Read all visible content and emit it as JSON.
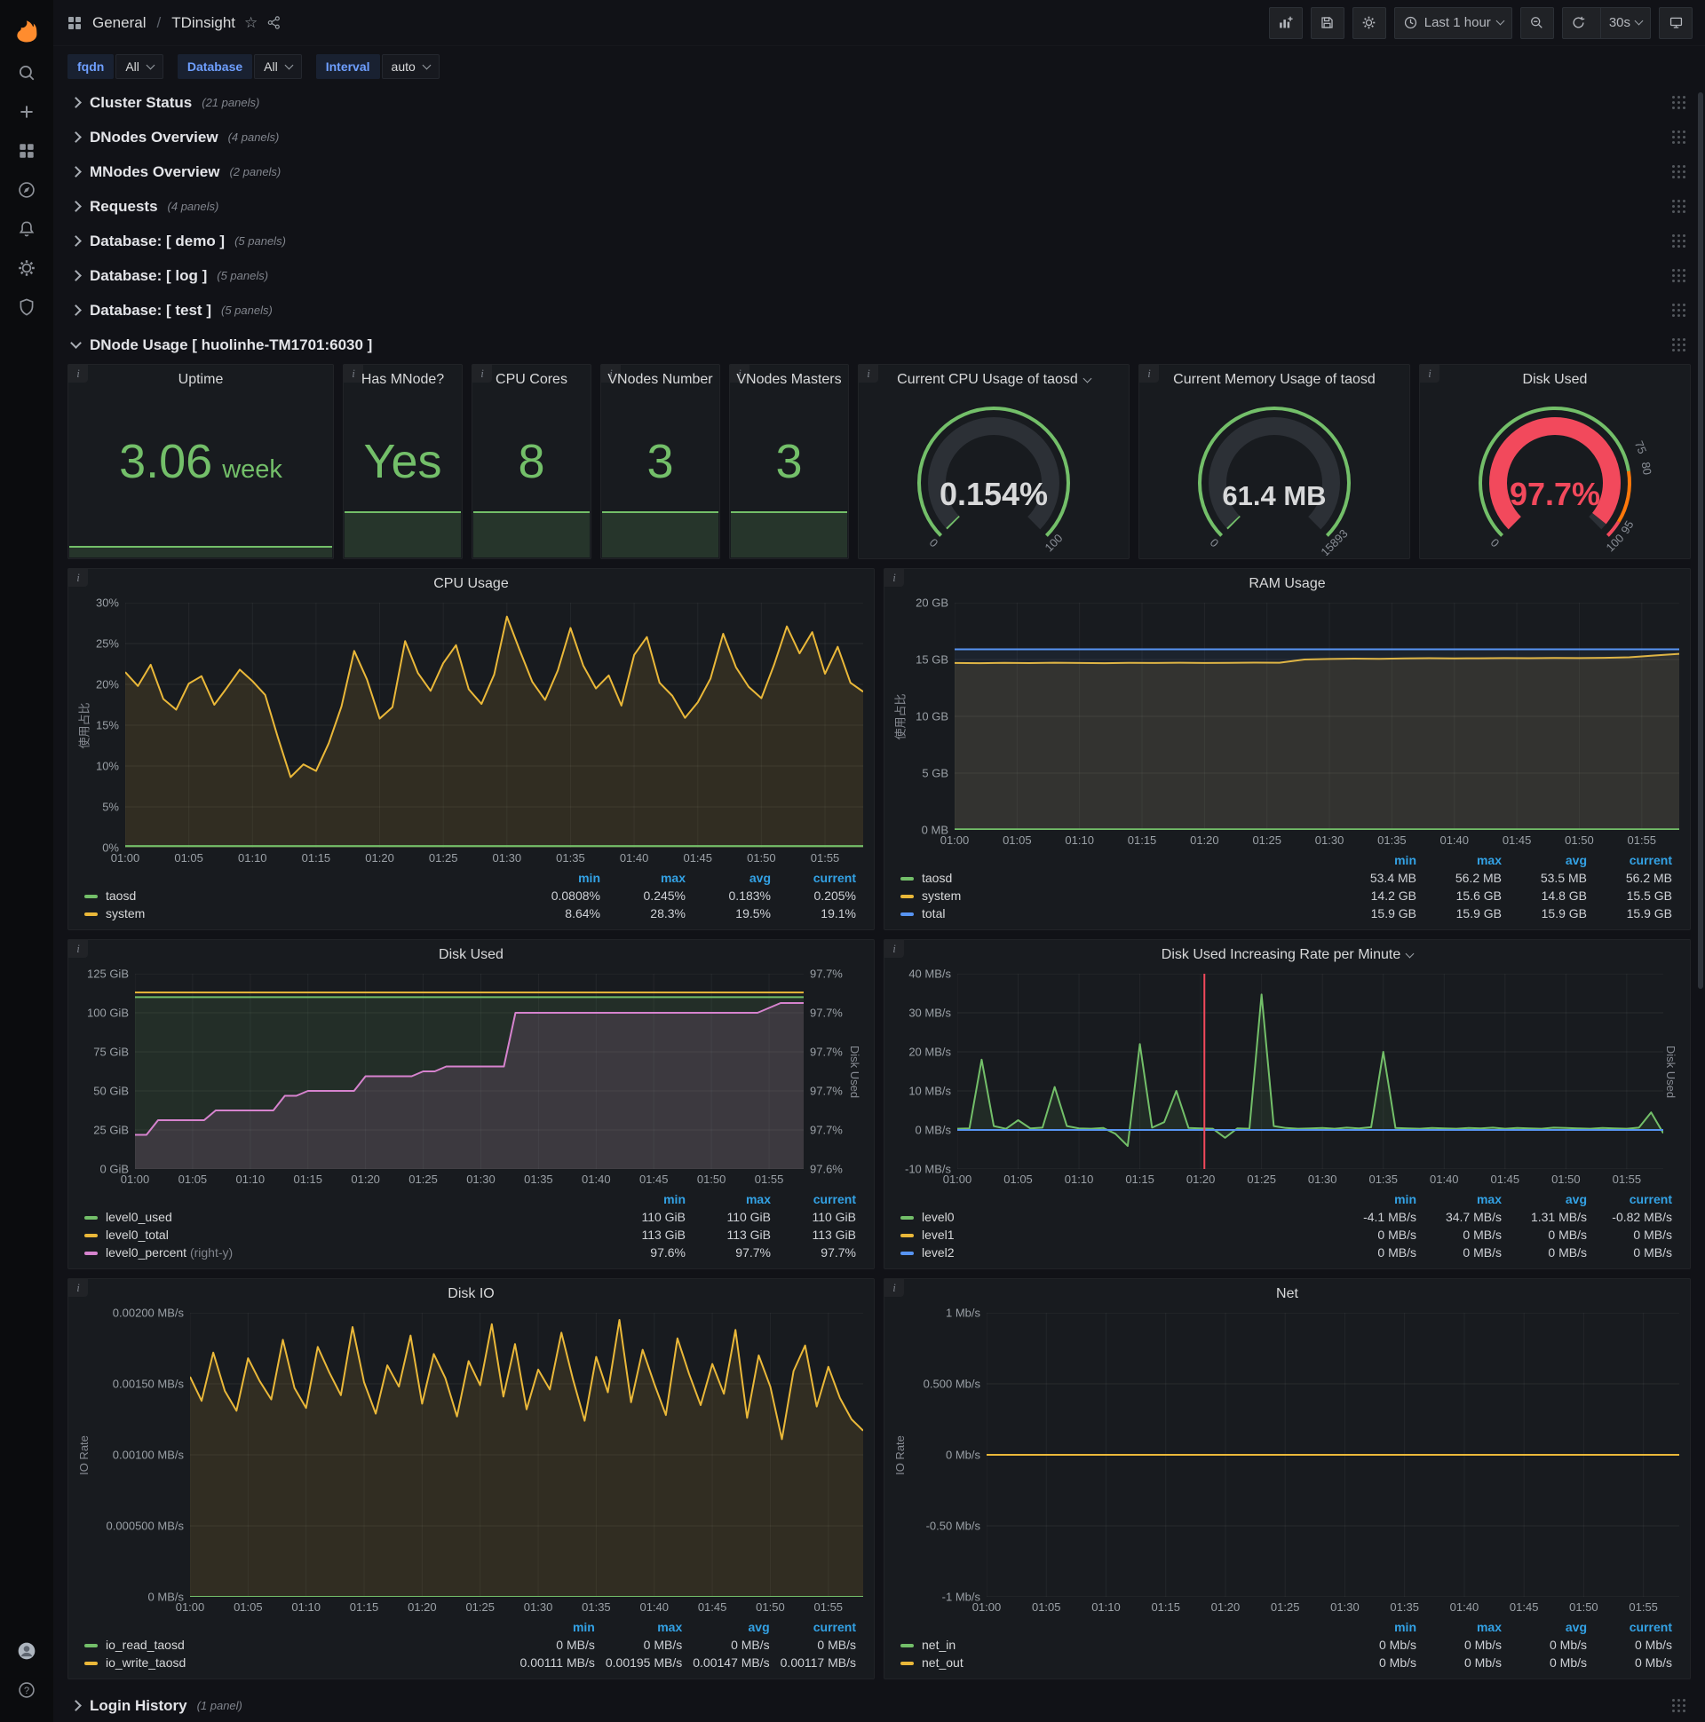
{
  "topnav": {
    "section": "General",
    "separator": "/",
    "title": "TDinsight",
    "time_range": "Last 1 hour",
    "refresh": "30s"
  },
  "icons": {
    "sidebar": [
      "grafana-logo",
      "search",
      "create-plus",
      "dashboards-grid",
      "explore-compass",
      "alerting-bell",
      "configuration-gear",
      "server-admin-shield",
      "user-avatar",
      "help"
    ],
    "topnav": [
      "apps-grid",
      "star",
      "share",
      "add-panel",
      "save-dashboard",
      "dashboard-settings-gear",
      "clock",
      "zoom-out",
      "refresh",
      "cycle-view-monitor"
    ]
  },
  "variables": [
    {
      "label": "fqdn",
      "value": "All"
    },
    {
      "label": "Database",
      "value": "All"
    },
    {
      "label": "Interval",
      "value": "auto"
    }
  ],
  "collapsed_rows": [
    {
      "title": "Cluster Status",
      "count": "(21 panels)"
    },
    {
      "title": "DNodes Overview",
      "count": "(4 panels)"
    },
    {
      "title": "MNodes Overview",
      "count": "(2 panels)"
    },
    {
      "title": "Requests",
      "count": "(4 panels)"
    },
    {
      "title": "Database: [ demo ]",
      "count": "(5 panels)"
    },
    {
      "title": "Database: [ log ]",
      "count": "(5 panels)"
    },
    {
      "title": "Database: [ test ]",
      "count": "(5 panels)"
    }
  ],
  "expanded_row": {
    "title": "DNode Usage [ huolinhe-TM1701:6030 ]"
  },
  "bottom_row": {
    "title": "Login History",
    "count": "(1 panel)"
  },
  "colors": {
    "green": "#73bf69",
    "yellow": "#eab839",
    "blue": "#5794f2",
    "pink": "#d683ce",
    "red": "#f2495c",
    "legend_header_blue": "#33a2e5"
  },
  "stats": [
    {
      "title": "Uptime",
      "value": "3.06",
      "unit": "week"
    },
    {
      "title": "Has MNode?",
      "value": "Yes"
    },
    {
      "title": "CPU Cores",
      "value": "8"
    },
    {
      "title": "VNodes Number",
      "value": "3"
    },
    {
      "title": "VNodes Masters",
      "value": "3"
    }
  ],
  "gauges": [
    {
      "title": "Current CPU Usage of taosd",
      "value": "0.154%",
      "pct": 0.154,
      "min_label": "0",
      "max_label": "100",
      "value_color": "#d8d9da",
      "bar_color": "#73bf69",
      "ring": [
        {
          "to": 100,
          "color": "#73bf69"
        }
      ],
      "threshold_labels": []
    },
    {
      "title": "Current Memory Usage of taosd",
      "value": "61.4 MB",
      "pct": 0.39,
      "min_label": "0",
      "max_label": "15893",
      "value_color": "#d8d9da",
      "bar_color": "#73bf69",
      "ring": [
        {
          "to": 100,
          "color": "#73bf69"
        }
      ],
      "threshold_labels": []
    },
    {
      "title": "Disk Used",
      "value": "97.7%",
      "pct": 97.7,
      "min_label": "0",
      "max_label": "100",
      "value_color": "#f2495c",
      "bar_color": "#f2495c",
      "ring": [
        {
          "to": 80,
          "color": "#73bf69"
        },
        {
          "to": 95,
          "color": "#ff780a"
        },
        {
          "to": 100,
          "color": "#f2495c"
        }
      ],
      "threshold_labels": [
        {
          "at": 75,
          "text": "75"
        },
        {
          "at": 80,
          "text": "80"
        },
        {
          "at": 95,
          "text": "95"
        }
      ]
    }
  ],
  "chart_data": [
    {
      "type": "line",
      "title": "CPU Usage",
      "ylabel": "使用占比",
      "ylim": [
        0,
        30
      ],
      "y_ticks": [
        "30%",
        "25%",
        "20%",
        "15%",
        "10%",
        "5%",
        "0%"
      ],
      "x_ticks": [
        "01:00",
        "01:05",
        "01:10",
        "01:15",
        "01:20",
        "01:25",
        "01:30",
        "01:35",
        "01:40",
        "01:45",
        "01:50",
        "01:55"
      ],
      "x_total": 58,
      "series": [
        {
          "name": "system",
          "color": "#eab839",
          "fill": 0.12,
          "values": [
            21.5,
            19.8,
            22.4,
            18.2,
            16.9,
            20.1,
            21.0,
            17.5,
            19.6,
            21.8,
            20.4,
            18.7,
            13.5,
            8.64,
            10.2,
            9.4,
            12.8,
            17.3,
            24.1,
            20.6,
            15.8,
            17.2,
            25.3,
            21.4,
            19.2,
            22.6,
            24.8,
            19.4,
            17.6,
            21.2,
            28.3,
            24.2,
            20.3,
            18.1,
            21.7,
            26.9,
            22.3,
            19.5,
            21.1,
            17.4,
            23.6,
            25.8,
            20.2,
            18.6,
            15.9,
            17.8,
            20.7,
            26.2,
            22.1,
            19.7,
            18.3,
            22.4,
            27.1,
            23.8,
            26.4,
            21.3,
            24.6,
            20.2,
            19.1
          ]
        },
        {
          "name": "taosd",
          "color": "#73bf69",
          "fill": 0.12,
          "values": [
            0.2,
            0.21
          ]
        }
      ],
      "legend": {
        "cols": [
          "min",
          "max",
          "avg",
          "current"
        ],
        "rows": [
          {
            "name": "taosd",
            "color": "#73bf69",
            "values": [
              "0.0808%",
              "0.245%",
              "0.183%",
              "0.205%"
            ]
          },
          {
            "name": "system",
            "color": "#eab839",
            "values": [
              "8.64%",
              "28.3%",
              "19.5%",
              "19.1%"
            ]
          }
        ]
      }
    },
    {
      "type": "line",
      "title": "RAM Usage",
      "ylabel": "使用占比",
      "ylim": [
        0,
        20
      ],
      "y_ticks": [
        "20 GB",
        "15 GB",
        "10 GB",
        "5 GB",
        "0 MB"
      ],
      "x_ticks": [
        "01:00",
        "01:05",
        "01:10",
        "01:15",
        "01:20",
        "01:25",
        "01:30",
        "01:35",
        "01:40",
        "01:45",
        "01:50",
        "01:55"
      ],
      "x_total": 58,
      "series": [
        {
          "name": "system",
          "color": "#eab839",
          "fill": 0.12,
          "values": [
            14.7,
            14.68,
            14.71,
            14.69,
            14.72,
            14.7,
            14.68,
            14.71,
            14.7,
            14.72,
            14.7,
            14.71,
            14.73,
            14.72,
            15.0,
            15.05,
            15.08,
            15.06,
            15.1,
            15.12,
            15.1,
            15.11,
            15.13,
            15.12,
            15.14,
            15.13,
            15.15,
            15.2,
            15.35,
            15.5
          ]
        },
        {
          "name": "total",
          "color": "#5794f2",
          "fill": 0.07,
          "values": [
            15.9,
            15.9
          ]
        },
        {
          "name": "taosd",
          "color": "#73bf69",
          "fill": 0.1,
          "values": [
            0.055,
            0.055
          ]
        }
      ],
      "legend": {
        "cols": [
          "min",
          "max",
          "avg",
          "current"
        ],
        "rows": [
          {
            "name": "taosd",
            "color": "#73bf69",
            "values": [
              "53.4 MB",
              "56.2 MB",
              "53.5 MB",
              "56.2 MB"
            ]
          },
          {
            "name": "system",
            "color": "#eab839",
            "values": [
              "14.2 GB",
              "15.6 GB",
              "14.8 GB",
              "15.5 GB"
            ]
          },
          {
            "name": "total",
            "color": "#5794f2",
            "values": [
              "15.9 GB",
              "15.9 GB",
              "15.9 GB",
              "15.9 GB"
            ]
          }
        ]
      }
    },
    {
      "type": "line",
      "title": "Disk Used",
      "ylim": [
        0,
        125
      ],
      "y_ticks": [
        "125 GiB",
        "100 GiB",
        "75 GiB",
        "50 GiB",
        "25 GiB",
        "0 GiB"
      ],
      "right_ticks": [
        "97.7%",
        "97.7%",
        "97.7%",
        "97.7%",
        "97.7%",
        "97.6%"
      ],
      "right_range": [
        97.55,
        97.75
      ],
      "right_label": "Disk Used",
      "x_ticks": [
        "01:00",
        "01:05",
        "01:10",
        "01:15",
        "01:20",
        "01:25",
        "01:30",
        "01:35",
        "01:40",
        "01:45",
        "01:50",
        "01:55"
      ],
      "x_total": 58,
      "series": [
        {
          "name": "level0_used",
          "color": "#73bf69",
          "fill": 0.12,
          "values": [
            110,
            110
          ]
        },
        {
          "name": "level0_percent",
          "color": "#d683ce",
          "fill": 0.14,
          "axis": "right",
          "values": [
            97.585,
            97.585,
            97.6,
            97.6,
            97.6,
            97.6,
            97.6,
            97.61,
            97.61,
            97.61,
            97.61,
            97.61,
            97.61,
            97.625,
            97.625,
            97.63,
            97.63,
            97.63,
            97.63,
            97.63,
            97.645,
            97.645,
            97.645,
            97.645,
            97.645,
            97.65,
            97.65,
            97.655,
            97.655,
            97.655,
            97.655,
            97.655,
            97.655,
            97.71,
            97.71,
            97.71,
            97.71,
            97.71,
            97.71,
            97.71,
            97.71,
            97.71,
            97.71,
            97.71,
            97.71,
            97.71,
            97.71,
            97.71,
            97.71,
            97.71,
            97.71,
            97.71,
            97.71,
            97.71,
            97.71,
            97.715,
            97.72,
            97.72,
            97.72
          ]
        },
        {
          "name": "level0_total",
          "color": "#eab839",
          "fill": 0,
          "values": [
            113,
            113
          ]
        }
      ],
      "legend": {
        "cols": [
          "min",
          "max",
          "current"
        ],
        "rows": [
          {
            "name": "level0_used",
            "color": "#73bf69",
            "values": [
              "110 GiB",
              "110 GiB",
              "110 GiB"
            ]
          },
          {
            "name": "level0_total",
            "color": "#eab839",
            "values": [
              "113 GiB",
              "113 GiB",
              "113 GiB"
            ]
          },
          {
            "name": "level0_percent",
            "suffix": "(right-y)",
            "color": "#d683ce",
            "values": [
              "97.6%",
              "97.7%",
              "97.7%"
            ]
          }
        ]
      }
    },
    {
      "type": "line",
      "title": "Disk Used Increasing Rate per Minute",
      "ylim": [
        -10,
        40
      ],
      "y_ticks": [
        "40 MB/s",
        "30 MB/s",
        "20 MB/s",
        "10 MB/s",
        "0 MB/s",
        "-10 MB/s"
      ],
      "right_label": "Disk Used",
      "annotation_x": 20.3,
      "x_ticks": [
        "01:00",
        "01:05",
        "01:10",
        "01:15",
        "01:20",
        "01:25",
        "01:30",
        "01:35",
        "01:40",
        "01:45",
        "01:50",
        "01:55"
      ],
      "x_total": 58,
      "series": [
        {
          "name": "level0",
          "color": "#73bf69",
          "fill": 0.1,
          "values": [
            0.3,
            0.4,
            18,
            1,
            0.3,
            2.5,
            0.4,
            0.6,
            11,
            1,
            0.4,
            0.3,
            0.5,
            -1,
            -4.1,
            22,
            0.6,
            2,
            10,
            0.5,
            0.4,
            0.3,
            -2,
            0.4,
            0.3,
            34.7,
            1,
            0.5,
            0.3,
            0.4,
            0.5,
            0.3,
            0.6,
            0.4,
            0.7,
            20,
            0.5,
            0.4,
            0.3,
            0.5,
            0.4,
            0.3,
            0.5,
            0.4,
            0.6,
            0.3,
            0.5,
            0.4,
            0.3,
            0.6,
            0.5,
            0.4,
            0.3,
            0.5,
            0.4,
            0.3,
            0.6,
            4.5,
            -0.82
          ]
        },
        {
          "name": "level1",
          "color": "#eab839",
          "fill": 0,
          "values": [
            0,
            0
          ]
        },
        {
          "name": "level2",
          "color": "#5794f2",
          "fill": 0,
          "values": [
            0,
            0
          ]
        }
      ],
      "legend": {
        "cols": [
          "min",
          "max",
          "avg",
          "current"
        ],
        "rows": [
          {
            "name": "level0",
            "color": "#73bf69",
            "values": [
              "-4.1 MB/s",
              "34.7 MB/s",
              "1.31 MB/s",
              "-0.82 MB/s"
            ]
          },
          {
            "name": "level1",
            "color": "#eab839",
            "values": [
              "0 MB/s",
              "0 MB/s",
              "0 MB/s",
              "0 MB/s"
            ]
          },
          {
            "name": "level2",
            "color": "#5794f2",
            "values": [
              "0 MB/s",
              "0 MB/s",
              "0 MB/s",
              "0 MB/s"
            ]
          }
        ]
      }
    },
    {
      "type": "line",
      "title": "Disk IO",
      "ylabel": "IO Rate",
      "ylim": [
        0,
        0.002
      ],
      "y_ticks": [
        "0.00200 MB/s",
        "0.00150 MB/s",
        "0.00100 MB/s",
        "0.000500 MB/s",
        "0 MB/s"
      ],
      "x_ticks": [
        "01:00",
        "01:05",
        "01:10",
        "01:15",
        "01:20",
        "01:25",
        "01:30",
        "01:35",
        "01:40",
        "01:45",
        "01:50",
        "01:55"
      ],
      "x_total": 58,
      "series": [
        {
          "name": "io_write_taosd",
          "color": "#eab839",
          "fill": 0.12,
          "values": [
            0.00155,
            0.00138,
            0.00172,
            0.00145,
            0.00131,
            0.00168,
            0.00152,
            0.00139,
            0.00181,
            0.00147,
            0.00133,
            0.00176,
            0.00158,
            0.00142,
            0.0019,
            0.00151,
            0.00129,
            0.00163,
            0.00148,
            0.00184,
            0.00136,
            0.00171,
            0.00154,
            0.00127,
            0.00166,
            0.00149,
            0.00192,
            0.00141,
            0.00178,
            0.00132,
            0.0016,
            0.00146,
            0.00186,
            0.00153,
            0.00124,
            0.00169,
            0.00144,
            0.00195,
            0.00137,
            0.00174,
            0.0015,
            0.00128,
            0.00182,
            0.00157,
            0.00135,
            0.00164,
            0.00143,
            0.00188,
            0.00126,
            0.0017,
            0.00148,
            0.00111,
            0.00159,
            0.00177,
            0.00134,
            0.00162,
            0.0014,
            0.00125,
            0.00117
          ]
        },
        {
          "name": "io_read_taosd",
          "color": "#73bf69",
          "fill": 0,
          "values": [
            0,
            0
          ]
        }
      ],
      "legend": {
        "cols": [
          "min",
          "max",
          "avg",
          "current"
        ],
        "rows": [
          {
            "name": "io_read_taosd",
            "color": "#73bf69",
            "values": [
              "0 MB/s",
              "0 MB/s",
              "0 MB/s",
              "0 MB/s"
            ]
          },
          {
            "name": "io_write_taosd",
            "color": "#eab839",
            "values": [
              "0.00111 MB/s",
              "0.00195 MB/s",
              "0.00147 MB/s",
              "0.00117 MB/s"
            ]
          }
        ]
      }
    },
    {
      "type": "line",
      "title": "Net",
      "ylabel": "IO Rate",
      "ylim": [
        -1,
        1
      ],
      "y_ticks": [
        "1 Mb/s",
        "0.500 Mb/s",
        "0 Mb/s",
        "-0.50 Mb/s",
        "-1 Mb/s"
      ],
      "x_ticks": [
        "01:00",
        "01:05",
        "01:10",
        "01:15",
        "01:20",
        "01:25",
        "01:30",
        "01:35",
        "01:40",
        "01:45",
        "01:50",
        "01:55"
      ],
      "x_total": 58,
      "series": [
        {
          "name": "net_in",
          "color": "#73bf69",
          "fill": 0,
          "values": [
            0,
            0
          ]
        },
        {
          "name": "net_out",
          "color": "#eab839",
          "fill": 0,
          "values": [
            0,
            0
          ]
        }
      ],
      "legend": {
        "cols": [
          "min",
          "max",
          "avg",
          "current"
        ],
        "rows": [
          {
            "name": "net_in",
            "color": "#73bf69",
            "values": [
              "0 Mb/s",
              "0 Mb/s",
              "0 Mb/s",
              "0 Mb/s"
            ]
          },
          {
            "name": "net_out",
            "color": "#eab839",
            "values": [
              "0 Mb/s",
              "0 Mb/s",
              "0 Mb/s",
              "0 Mb/s"
            ]
          }
        ]
      }
    }
  ]
}
